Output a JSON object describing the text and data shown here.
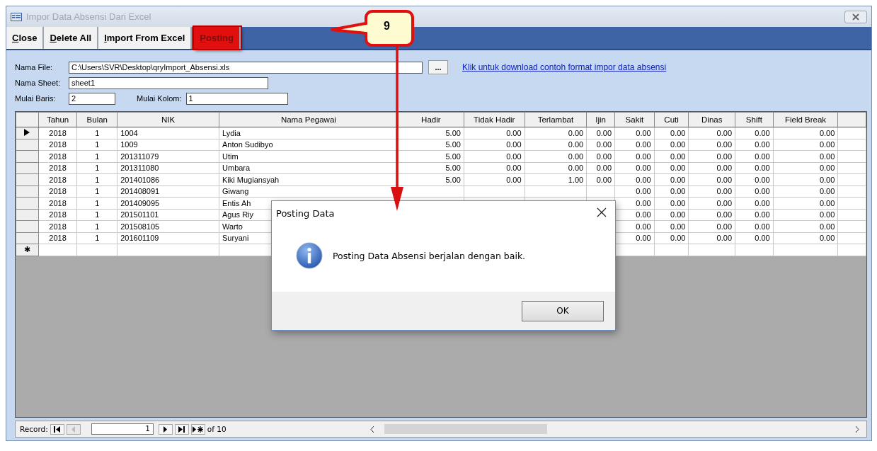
{
  "window": {
    "title": "Impor Data Absensi Dari Excel"
  },
  "toolbar": [
    {
      "label": "Close",
      "highlighted": false
    },
    {
      "label": "Delete All",
      "highlighted": false
    },
    {
      "label": "Import From Excel",
      "highlighted": false
    },
    {
      "label": "Posting",
      "highlighted": true
    }
  ],
  "callout": {
    "label": "9"
  },
  "form": {
    "file_label": "Nama File:",
    "file_value": "C:\\Users\\SVR\\Desktop\\qryImport_Absensi.xls",
    "browse": "...",
    "link": "Klik untuk download contoh format impor data absensi",
    "sheet_label": "Nama Sheet:",
    "sheet_value": "sheet1",
    "row_label": "Mulai Baris:",
    "row_value": "2",
    "col_label": "Mulai Kolom:",
    "col_value": "1"
  },
  "table": {
    "columns": [
      "Tahun",
      "Bulan",
      "NIK",
      "Nama Pegawai",
      "Hadir",
      "Tidak Hadir",
      "Terlambat",
      "Ijin",
      "Sakit",
      "Cuti",
      "Dinas",
      "Shift",
      "Field Break"
    ],
    "rows": [
      {
        "current": true,
        "cells": [
          "2018",
          "1",
          "1004",
          "Lydia",
          "5.00",
          "0.00",
          "0.00",
          "0.00",
          "0.00",
          "0.00",
          "0.00",
          "0.00",
          "0.00"
        ]
      },
      {
        "current": false,
        "cells": [
          "2018",
          "1",
          "1009",
          "Anton Sudibyo",
          "5.00",
          "0.00",
          "0.00",
          "0.00",
          "0.00",
          "0.00",
          "0.00",
          "0.00",
          "0.00"
        ]
      },
      {
        "current": false,
        "cells": [
          "2018",
          "1",
          "201311079",
          "Utim",
          "5.00",
          "0.00",
          "0.00",
          "0.00",
          "0.00",
          "0.00",
          "0.00",
          "0.00",
          "0.00"
        ]
      },
      {
        "current": false,
        "cells": [
          "2018",
          "1",
          "201311080",
          "Umbara",
          "5.00",
          "0.00",
          "0.00",
          "0.00",
          "0.00",
          "0.00",
          "0.00",
          "0.00",
          "0.00"
        ]
      },
      {
        "current": false,
        "cells": [
          "2018",
          "1",
          "201401086",
          "Kiki Mugiansyah",
          "5.00",
          "0.00",
          "1.00",
          "0.00",
          "0.00",
          "0.00",
          "0.00",
          "0.00",
          "0.00"
        ]
      },
      {
        "current": false,
        "cells": [
          "2018",
          "1",
          "201408091",
          "Giwang",
          null,
          null,
          null,
          null,
          "0.00",
          "0.00",
          "0.00",
          "0.00",
          "0.00"
        ]
      },
      {
        "current": false,
        "cells": [
          "2018",
          "1",
          "201409095",
          "Entis Ah",
          null,
          null,
          null,
          null,
          "0.00",
          "0.00",
          "0.00",
          "0.00",
          "0.00"
        ]
      },
      {
        "current": false,
        "cells": [
          "2018",
          "1",
          "201501101",
          "Agus Riy",
          null,
          null,
          null,
          null,
          "0.00",
          "0.00",
          "0.00",
          "0.00",
          "0.00"
        ]
      },
      {
        "current": false,
        "cells": [
          "2018",
          "1",
          "201508105",
          "Warto",
          null,
          null,
          null,
          null,
          "0.00",
          "0.00",
          "0.00",
          "0.00",
          "0.00"
        ]
      },
      {
        "current": false,
        "cells": [
          "2018",
          "1",
          "201601109",
          "Suryani",
          null,
          null,
          null,
          null,
          "0.00",
          "0.00",
          "0.00",
          "0.00",
          "0.00"
        ]
      }
    ],
    "new_row_marker": "✱"
  },
  "record_nav": {
    "label": "Record:",
    "current": "1",
    "total": "of 10"
  },
  "dialog": {
    "title": "Posting Data",
    "message": "Posting Data Absensi berjalan dengan baik.",
    "button": "OK"
  }
}
